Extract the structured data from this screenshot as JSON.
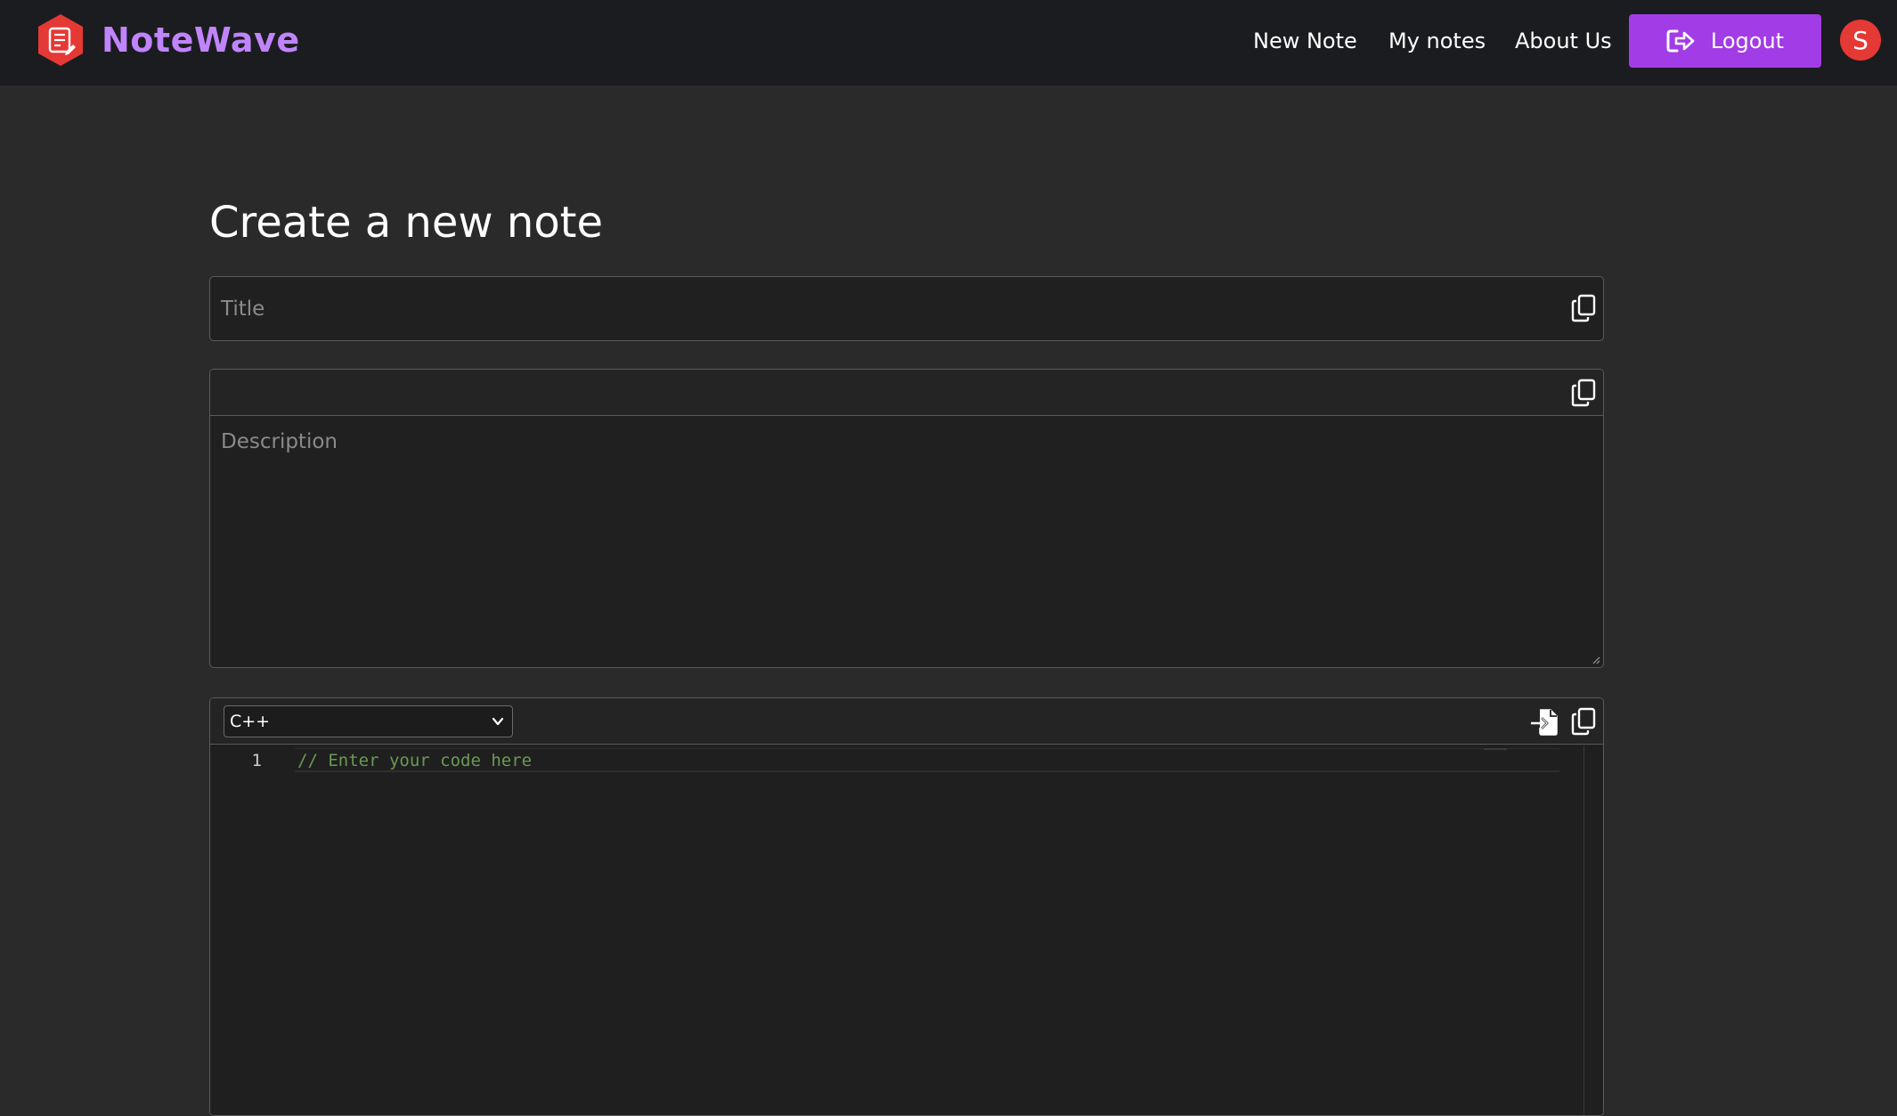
{
  "app": {
    "name": "NoteWave",
    "logo_icon": "note-edit-icon",
    "brand_color": "#c084fc",
    "logo_color": "#e53935"
  },
  "nav": {
    "links": [
      {
        "label": "New Note"
      },
      {
        "label": "My notes"
      },
      {
        "label": "About Us"
      }
    ],
    "logout_label": "Logout",
    "logout_icon": "logout-icon",
    "logout_color": "#a23ce6",
    "avatar_initial": "S",
    "avatar_color": "#e53935"
  },
  "main": {
    "heading": "Create a new note",
    "title_field": {
      "value": "",
      "placeholder": "Title",
      "copy_icon": "copy-icon"
    },
    "description_field": {
      "value": "",
      "placeholder": "Description",
      "copy_icon": "copy-icon"
    },
    "code_editor": {
      "language": "C++",
      "import_icon": "file-import-icon",
      "copy_icon": "copy-icon",
      "line_numbers": [
        "1"
      ],
      "lines": [
        "// Enter your code here"
      ]
    }
  }
}
